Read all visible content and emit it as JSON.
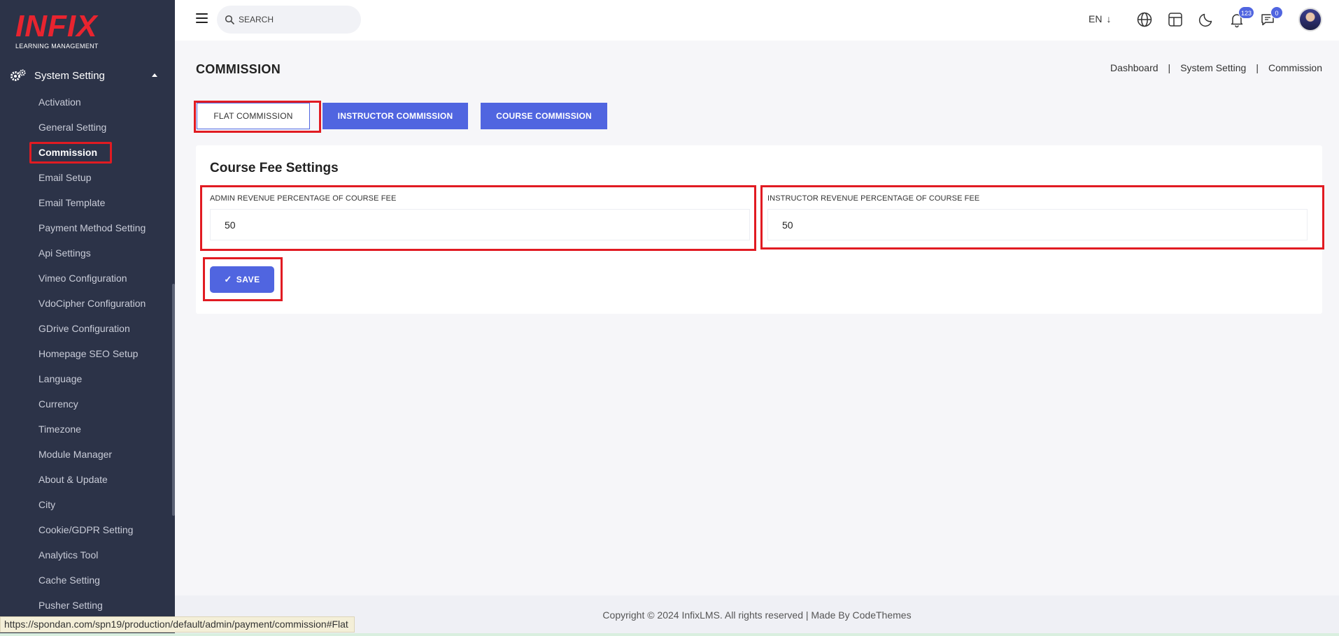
{
  "logo": {
    "main": "INFIX",
    "sub": "LEARNING MANAGEMENT"
  },
  "sidebar": {
    "group_label": "System Setting",
    "items": [
      {
        "label": "Activation"
      },
      {
        "label": "General Setting"
      },
      {
        "label": "Commission",
        "active": true
      },
      {
        "label": "Email Setup"
      },
      {
        "label": "Email Template"
      },
      {
        "label": "Payment Method Setting"
      },
      {
        "label": "Api Settings"
      },
      {
        "label": "Vimeo Configuration"
      },
      {
        "label": "VdoCipher Configuration"
      },
      {
        "label": "GDrive Configuration"
      },
      {
        "label": "Homepage SEO Setup"
      },
      {
        "label": "Language"
      },
      {
        "label": "Currency"
      },
      {
        "label": "Timezone"
      },
      {
        "label": "Module Manager"
      },
      {
        "label": "About & Update"
      },
      {
        "label": "City"
      },
      {
        "label": "Cookie/GDPR Setting"
      },
      {
        "label": "Analytics Tool"
      },
      {
        "label": "Cache Setting"
      },
      {
        "label": "Pusher Setting"
      }
    ]
  },
  "topbar": {
    "search_placeholder": "SEARCH",
    "language": "EN",
    "notifications_count": "123",
    "messages_count": "0"
  },
  "page": {
    "title": "COMMISSION",
    "breadcrumb": [
      "Dashboard",
      "System Setting",
      "Commission"
    ]
  },
  "tabs": {
    "flat": "FLAT COMMISSION",
    "instructor": "INSTRUCTOR COMMISSION",
    "course": "COURSE COMMISSION"
  },
  "form": {
    "title": "Course Fee Settings",
    "admin_label": "ADMIN REVENUE PERCENTAGE OF COURSE FEE",
    "admin_value": "50",
    "instructor_label": "INSTRUCTOR REVENUE PERCENTAGE OF COURSE FEE",
    "instructor_value": "50",
    "save_label": "SAVE"
  },
  "footer": {
    "text": "Copyright © 2024 InfixLMS. All rights reserved | Made By CodeThemes"
  },
  "status_url": "https://spondan.com/spn19/production/default/admin/payment/commission#Flat",
  "colors": {
    "sidebar": "#2c3348",
    "accent": "#5065e0",
    "highlight": "#e11b22"
  }
}
